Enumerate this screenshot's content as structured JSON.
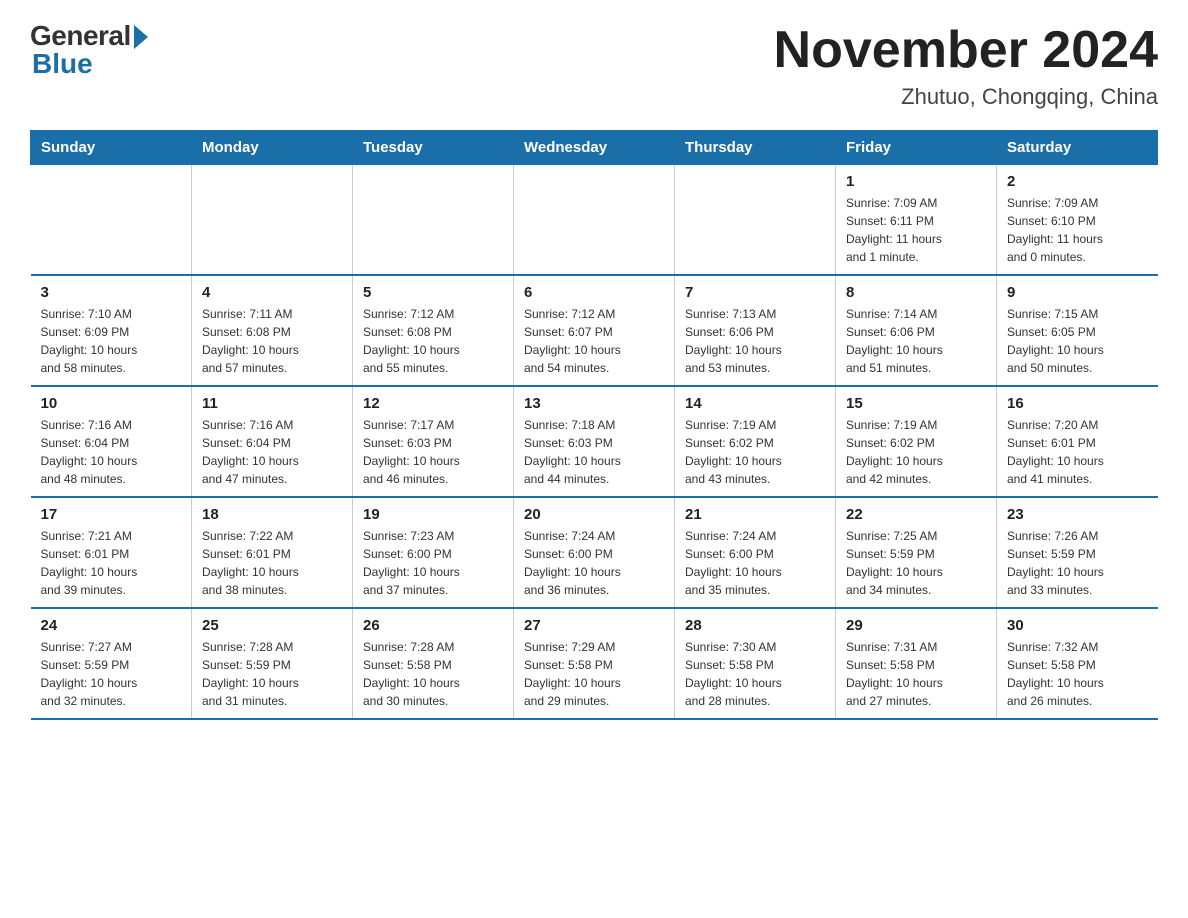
{
  "logo": {
    "general": "General",
    "blue": "Blue"
  },
  "title": "November 2024",
  "location": "Zhutuo, Chongqing, China",
  "days_of_week": [
    "Sunday",
    "Monday",
    "Tuesday",
    "Wednesday",
    "Thursday",
    "Friday",
    "Saturday"
  ],
  "weeks": [
    [
      {
        "day": "",
        "info": ""
      },
      {
        "day": "",
        "info": ""
      },
      {
        "day": "",
        "info": ""
      },
      {
        "day": "",
        "info": ""
      },
      {
        "day": "",
        "info": ""
      },
      {
        "day": "1",
        "info": "Sunrise: 7:09 AM\nSunset: 6:11 PM\nDaylight: 11 hours\nand 1 minute."
      },
      {
        "day": "2",
        "info": "Sunrise: 7:09 AM\nSunset: 6:10 PM\nDaylight: 11 hours\nand 0 minutes."
      }
    ],
    [
      {
        "day": "3",
        "info": "Sunrise: 7:10 AM\nSunset: 6:09 PM\nDaylight: 10 hours\nand 58 minutes."
      },
      {
        "day": "4",
        "info": "Sunrise: 7:11 AM\nSunset: 6:08 PM\nDaylight: 10 hours\nand 57 minutes."
      },
      {
        "day": "5",
        "info": "Sunrise: 7:12 AM\nSunset: 6:08 PM\nDaylight: 10 hours\nand 55 minutes."
      },
      {
        "day": "6",
        "info": "Sunrise: 7:12 AM\nSunset: 6:07 PM\nDaylight: 10 hours\nand 54 minutes."
      },
      {
        "day": "7",
        "info": "Sunrise: 7:13 AM\nSunset: 6:06 PM\nDaylight: 10 hours\nand 53 minutes."
      },
      {
        "day": "8",
        "info": "Sunrise: 7:14 AM\nSunset: 6:06 PM\nDaylight: 10 hours\nand 51 minutes."
      },
      {
        "day": "9",
        "info": "Sunrise: 7:15 AM\nSunset: 6:05 PM\nDaylight: 10 hours\nand 50 minutes."
      }
    ],
    [
      {
        "day": "10",
        "info": "Sunrise: 7:16 AM\nSunset: 6:04 PM\nDaylight: 10 hours\nand 48 minutes."
      },
      {
        "day": "11",
        "info": "Sunrise: 7:16 AM\nSunset: 6:04 PM\nDaylight: 10 hours\nand 47 minutes."
      },
      {
        "day": "12",
        "info": "Sunrise: 7:17 AM\nSunset: 6:03 PM\nDaylight: 10 hours\nand 46 minutes."
      },
      {
        "day": "13",
        "info": "Sunrise: 7:18 AM\nSunset: 6:03 PM\nDaylight: 10 hours\nand 44 minutes."
      },
      {
        "day": "14",
        "info": "Sunrise: 7:19 AM\nSunset: 6:02 PM\nDaylight: 10 hours\nand 43 minutes."
      },
      {
        "day": "15",
        "info": "Sunrise: 7:19 AM\nSunset: 6:02 PM\nDaylight: 10 hours\nand 42 minutes."
      },
      {
        "day": "16",
        "info": "Sunrise: 7:20 AM\nSunset: 6:01 PM\nDaylight: 10 hours\nand 41 minutes."
      }
    ],
    [
      {
        "day": "17",
        "info": "Sunrise: 7:21 AM\nSunset: 6:01 PM\nDaylight: 10 hours\nand 39 minutes."
      },
      {
        "day": "18",
        "info": "Sunrise: 7:22 AM\nSunset: 6:01 PM\nDaylight: 10 hours\nand 38 minutes."
      },
      {
        "day": "19",
        "info": "Sunrise: 7:23 AM\nSunset: 6:00 PM\nDaylight: 10 hours\nand 37 minutes."
      },
      {
        "day": "20",
        "info": "Sunrise: 7:24 AM\nSunset: 6:00 PM\nDaylight: 10 hours\nand 36 minutes."
      },
      {
        "day": "21",
        "info": "Sunrise: 7:24 AM\nSunset: 6:00 PM\nDaylight: 10 hours\nand 35 minutes."
      },
      {
        "day": "22",
        "info": "Sunrise: 7:25 AM\nSunset: 5:59 PM\nDaylight: 10 hours\nand 34 minutes."
      },
      {
        "day": "23",
        "info": "Sunrise: 7:26 AM\nSunset: 5:59 PM\nDaylight: 10 hours\nand 33 minutes."
      }
    ],
    [
      {
        "day": "24",
        "info": "Sunrise: 7:27 AM\nSunset: 5:59 PM\nDaylight: 10 hours\nand 32 minutes."
      },
      {
        "day": "25",
        "info": "Sunrise: 7:28 AM\nSunset: 5:59 PM\nDaylight: 10 hours\nand 31 minutes."
      },
      {
        "day": "26",
        "info": "Sunrise: 7:28 AM\nSunset: 5:58 PM\nDaylight: 10 hours\nand 30 minutes."
      },
      {
        "day": "27",
        "info": "Sunrise: 7:29 AM\nSunset: 5:58 PM\nDaylight: 10 hours\nand 29 minutes."
      },
      {
        "day": "28",
        "info": "Sunrise: 7:30 AM\nSunset: 5:58 PM\nDaylight: 10 hours\nand 28 minutes."
      },
      {
        "day": "29",
        "info": "Sunrise: 7:31 AM\nSunset: 5:58 PM\nDaylight: 10 hours\nand 27 minutes."
      },
      {
        "day": "30",
        "info": "Sunrise: 7:32 AM\nSunset: 5:58 PM\nDaylight: 10 hours\nand 26 minutes."
      }
    ]
  ]
}
